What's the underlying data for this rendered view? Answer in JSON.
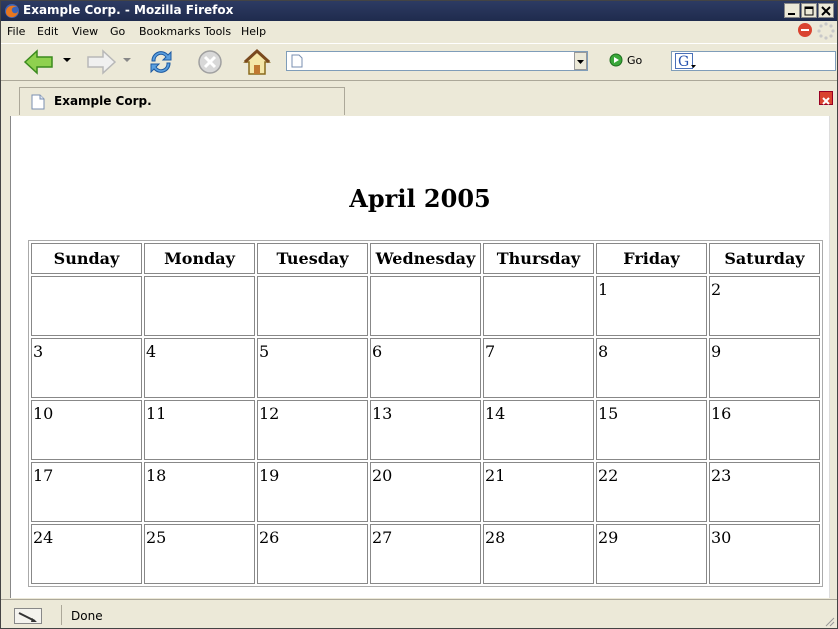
{
  "window": {
    "title": "Example Corp. - Mozilla Firefox"
  },
  "menu": {
    "items": [
      {
        "label": "File"
      },
      {
        "label": "Edit"
      },
      {
        "label": "View"
      },
      {
        "label": "Go"
      },
      {
        "label": "Bookmarks"
      },
      {
        "label": "Tools"
      },
      {
        "label": "Help"
      }
    ]
  },
  "navbar": {
    "url_value": "",
    "go_label": "Go",
    "search_value": ""
  },
  "tabs": [
    {
      "label": "Example Corp."
    }
  ],
  "calendar": {
    "title": "April 2005",
    "days": [
      "Sunday",
      "Monday",
      "Tuesday",
      "Wednesday",
      "Thursday",
      "Friday",
      "Saturday"
    ],
    "weeks": [
      [
        "",
        "",
        "",
        "",
        "",
        "1",
        "2"
      ],
      [
        "3",
        "4",
        "5",
        "6",
        "7",
        "8",
        "9"
      ],
      [
        "10",
        "11",
        "12",
        "13",
        "14",
        "15",
        "16"
      ],
      [
        "17",
        "18",
        "19",
        "20",
        "21",
        "22",
        "23"
      ],
      [
        "24",
        "25",
        "26",
        "27",
        "28",
        "29",
        "30"
      ]
    ]
  },
  "status": {
    "text": "Done"
  },
  "colors": {
    "titlebar": "#2d3b63",
    "chrome": "#ece9d8",
    "tab_close": "#d9432f"
  }
}
